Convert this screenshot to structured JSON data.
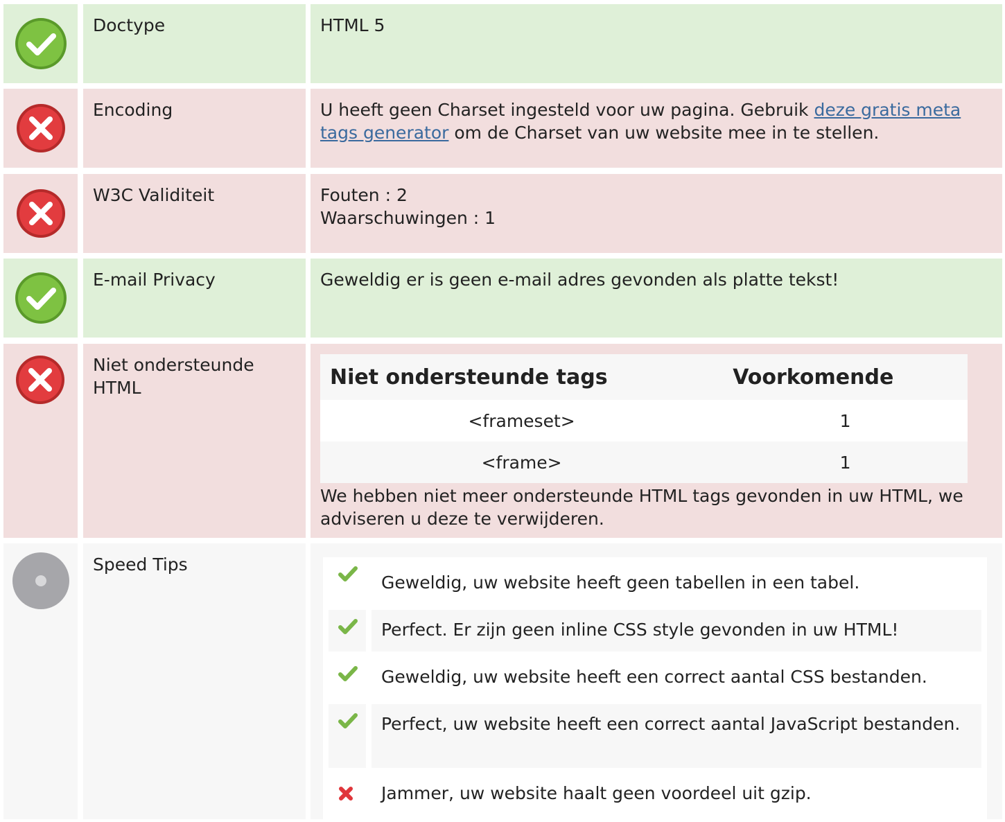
{
  "rows": {
    "doctype": {
      "label": "Doctype",
      "value": "HTML 5",
      "status": "pass"
    },
    "encoding": {
      "label": "Encoding",
      "status": "fail",
      "text_before": "U heeft geen Charset ingesteld voor uw pagina. Gebruik ",
      "link_text": "deze gratis meta tags generator",
      "text_after": " om de Charset van uw website mee in te stellen."
    },
    "w3c": {
      "label": "W3C Validiteit",
      "status": "fail",
      "errors": "Fouten : 2",
      "warnings": "Waarschuwingen : 1"
    },
    "email": {
      "label": "E-mail Privacy",
      "status": "pass",
      "value": "Geweldig er is geen e-mail adres gevonden als platte tekst!"
    },
    "unsupported": {
      "label": "Niet ondersteunde HTML",
      "status": "fail",
      "table": {
        "headers": [
          "Niet ondersteunde tags",
          "Voorkomende"
        ],
        "rows": [
          [
            "<frameset>",
            "1"
          ],
          [
            "<frame>",
            "1"
          ]
        ]
      },
      "note": "We hebben niet meer ondersteunde HTML tags gevonden in uw HTML, we adviseren u deze te verwijderen."
    },
    "speed": {
      "label": "Speed Tips",
      "status": "neutral",
      "tips": [
        {
          "text": "Geweldig, uw website heeft geen tabellen in een tabel.",
          "ok": true
        },
        {
          "text": "Perfect. Er zijn geen inline CSS style gevonden in uw HTML!",
          "ok": true
        },
        {
          "text": "Geweldig, uw website heeft een correct aantal CSS bestanden.",
          "ok": true
        },
        {
          "text": "Perfect, uw website heeft een correct aantal JavaScript bestanden.",
          "ok": true
        },
        {
          "text": "Jammer, uw website haalt geen voordeel uit gzip.",
          "ok": false
        }
      ]
    }
  },
  "colors": {
    "pass_bg": "#dff0d8",
    "fail_bg": "#f2dede",
    "neutral_bg": "#f7f7f7",
    "check_green": "#7ab648",
    "cross_red": "#e0363b",
    "link": "#3a6a9e"
  },
  "icons": {
    "pass": "check-circle-icon",
    "fail": "x-circle-icon",
    "neutral": "grey-circle-icon"
  }
}
